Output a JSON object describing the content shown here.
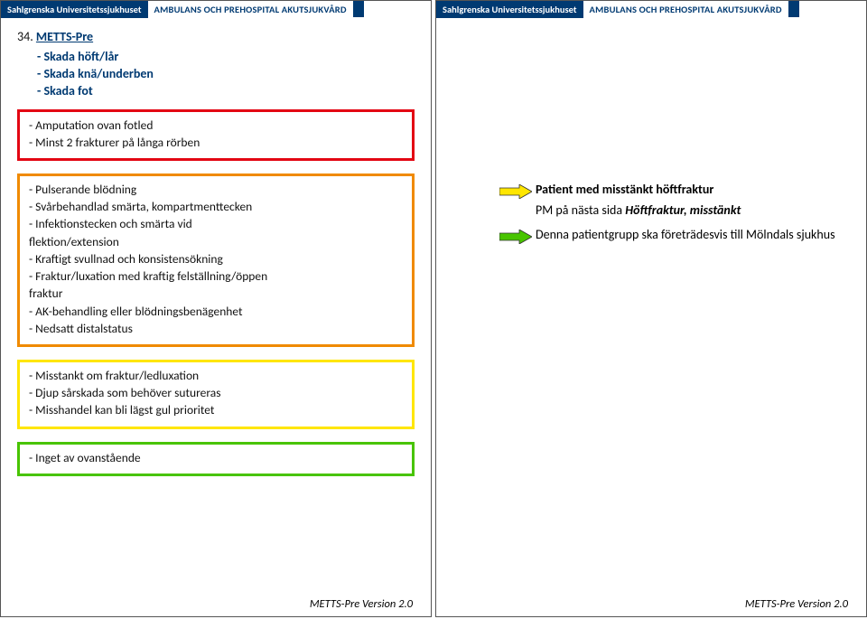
{
  "header": {
    "org": "Sahlgrenska Universitetssjukhuset",
    "dept": "AMBULANS OCH PREHOSPITAL AKUTSJUKVÅRD"
  },
  "left": {
    "number": "34.",
    "title": "METTS-Pre",
    "subitems": [
      "- Skada höft/lår",
      "- Skada knä/underben",
      "- Skada fot"
    ],
    "red": [
      "- Amputation ovan fotled",
      "- Minst 2 frakturer på långa rörben"
    ],
    "orange": [
      "- Pulserande blödning",
      "- Svårbehandlad smärta, kompartmenttecken",
      "- Infektionstecken och smärta vid",
      "  flektion/extension",
      "- Kraftigt svullnad och konsistensökning",
      "- Fraktur/luxation med kraftig felställning/öppen",
      "  fraktur",
      "- AK-behandling eller blödningsbenägenhet",
      "- Nedsatt distalstatus"
    ],
    "yellow": [
      "- Misstankt om fraktur/ledluxation",
      "- Djup sårskada som behöver sutureras",
      "- Misshandel kan bli lägst gul prioritet"
    ],
    "green": [
      "- Inget av ovanstående"
    ]
  },
  "right": {
    "line1a": "Patient med misstänkt höftfraktur",
    "line2a": "PM på nästa sida ",
    "line2b": "Höftfraktur, misstänkt",
    "line3": "Denna patientgrupp ska företrädesvis till Mölndals sjukhus"
  },
  "footer": "METTS-Pre Version 2.0",
  "colors": {
    "yellow_fill": "#ffe600",
    "green_fill": "#48c400"
  }
}
